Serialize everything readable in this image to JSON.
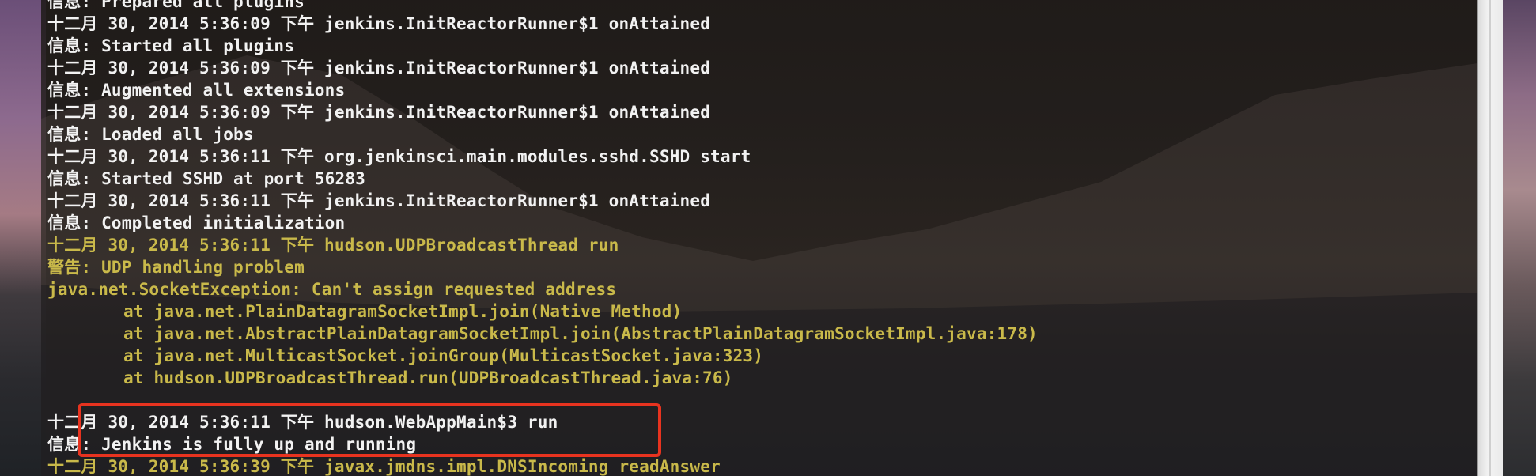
{
  "terminal": {
    "lines": [
      {
        "text": "信息: Prepared all plugins",
        "color": "white"
      },
      {
        "text": "十二月 30, 2014 5:36:09 下午 jenkins.InitReactorRunner$1 onAttained",
        "color": "white"
      },
      {
        "text": "信息: Started all plugins",
        "color": "white"
      },
      {
        "text": "十二月 30, 2014 5:36:09 下午 jenkins.InitReactorRunner$1 onAttained",
        "color": "white"
      },
      {
        "text": "信息: Augmented all extensions",
        "color": "white"
      },
      {
        "text": "十二月 30, 2014 5:36:09 下午 jenkins.InitReactorRunner$1 onAttained",
        "color": "white"
      },
      {
        "text": "信息: Loaded all jobs",
        "color": "white"
      },
      {
        "text": "十二月 30, 2014 5:36:11 下午 org.jenkinsci.main.modules.sshd.SSHD start",
        "color": "white"
      },
      {
        "text": "信息: Started SSHD at port 56283",
        "color": "white"
      },
      {
        "text": "十二月 30, 2014 5:36:11 下午 jenkins.InitReactorRunner$1 onAttained",
        "color": "white"
      },
      {
        "text": "信息: Completed initialization",
        "color": "white"
      },
      {
        "text": "十二月 30, 2014 5:36:11 下午 hudson.UDPBroadcastThread run",
        "color": "yellow"
      },
      {
        "text": "警告: UDP handling problem",
        "color": "yellow"
      },
      {
        "text": "java.net.SocketException: Can't assign requested address",
        "color": "yellow"
      },
      {
        "text": "at java.net.PlainDatagramSocketImpl.join(Native Method)",
        "color": "yellow",
        "indent": true
      },
      {
        "text": "at java.net.AbstractPlainDatagramSocketImpl.join(AbstractPlainDatagramSocketImpl.java:178)",
        "color": "yellow",
        "indent": true
      },
      {
        "text": "at java.net.MulticastSocket.joinGroup(MulticastSocket.java:323)",
        "color": "yellow",
        "indent": true
      },
      {
        "text": "at hudson.UDPBroadcastThread.run(UDPBroadcastThread.java:76)",
        "color": "yellow",
        "indent": true
      },
      {
        "text": "",
        "color": "white"
      },
      {
        "text": "十二月 30, 2014 5:36:11 下午 hudson.WebAppMain$3 run",
        "color": "white"
      },
      {
        "text": "信息: Jenkins is fully up and running",
        "color": "white"
      },
      {
        "text": "十二月 30, 2014 5:36:39 下午 javax.jmdns.impl.DNSIncoming readAnswer",
        "color": "yellow"
      }
    ]
  },
  "highlight": {
    "color": "#e8331f",
    "note_lines": [
      19,
      20
    ]
  },
  "colors": {
    "white_text": "#f2f2f2",
    "yellow_text": "#c9b94a",
    "highlight": "#e8331f"
  }
}
